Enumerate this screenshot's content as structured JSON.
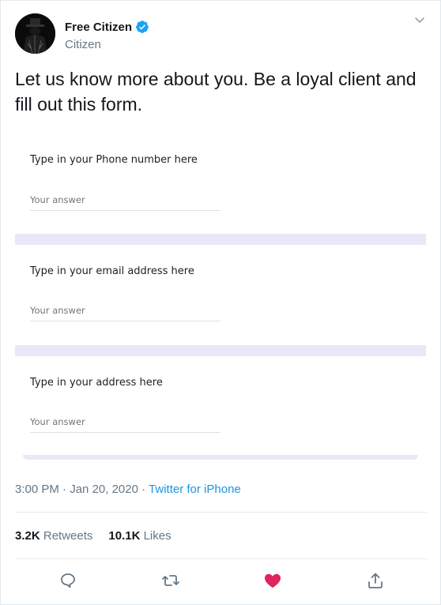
{
  "author": {
    "display_name": "Free Citizen",
    "handle": "Citizen",
    "verified_icon": "verified-badge-icon",
    "avatar_icon": "avatar-image"
  },
  "tweet": {
    "text": "Let us know more about you. Be a loyal client and fill out this form.",
    "time": "3:00 PM",
    "date": "Jan 20, 2020",
    "separator": " · ",
    "source": "Twitter for iPhone"
  },
  "form": {
    "questions": [
      {
        "label": "Type in your Phone number here",
        "placeholder": "Your answer"
      },
      {
        "label": "Type in your email address here",
        "placeholder": "Your answer"
      },
      {
        "label": "Type in your address here",
        "placeholder": "Your answer"
      }
    ]
  },
  "stats": {
    "retweets_count": "3.2K",
    "retweets_label": "Retweets",
    "likes_count": "10.1K",
    "likes_label": "Likes"
  },
  "actions": [
    "reply-icon",
    "retweet-icon",
    "like-icon",
    "share-icon"
  ],
  "colors": {
    "link": "#1b95e0",
    "like": "#e0245e",
    "muted": "#657786",
    "verified": "#1da1f2",
    "form_separator": "#ebe7f6"
  }
}
